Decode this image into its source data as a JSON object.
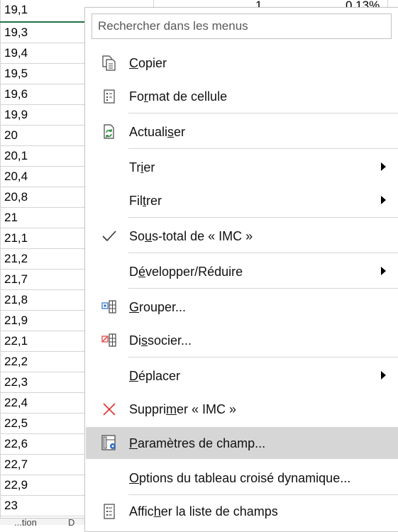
{
  "sheet": {
    "rows": [
      "19,1",
      "19,3",
      "19,4",
      "19,5",
      "19,6",
      "19,9",
      "20",
      "20,1",
      "20,4",
      "20,8",
      "21",
      "21,1",
      "21,2",
      "21,7",
      "21,8",
      "21,9",
      "22,1",
      "22,2",
      "22,3",
      "22,4",
      "22,5",
      "22,6",
      "22,7",
      "22,9",
      "23"
    ],
    "row1_count": "1",
    "row1_percent": "0,13%",
    "tab_fragment_1": "...tion",
    "tab_fragment_2": "D"
  },
  "menu": {
    "search_placeholder": "Rechercher dans les menus",
    "items": [
      {
        "pre": "",
        "u": "C",
        "post": "opier",
        "icon": "copy-icon"
      },
      {
        "pre": "Fo",
        "u": "r",
        "post": "mat de cellule",
        "icon": "format-cells-icon"
      },
      {
        "pre": "Actuali",
        "u": "s",
        "post": "er",
        "icon": "refresh-icon"
      },
      {
        "pre": "Tr",
        "u": "i",
        "post": "er",
        "icon": ""
      },
      {
        "pre": "Fil",
        "u": "t",
        "post": "rer",
        "icon": ""
      },
      {
        "pre": "So",
        "u": "u",
        "post": "s-total de « IMC »",
        "icon": "checkmark-icon"
      },
      {
        "pre": "D",
        "u": "é",
        "post": "velopper/Réduire",
        "icon": ""
      },
      {
        "pre": "",
        "u": "G",
        "post": "rouper...",
        "icon": "group-icon"
      },
      {
        "pre": "Di",
        "u": "s",
        "post": "socier...",
        "icon": "ungroup-icon"
      },
      {
        "pre": "",
        "u": "D",
        "post": "éplacer",
        "icon": ""
      },
      {
        "pre": "Suppri",
        "u": "m",
        "post": "er « IMC »",
        "icon": "delete-x-icon"
      },
      {
        "pre": "",
        "u": "P",
        "post": "aramètres de champ...",
        "icon": "field-settings-icon"
      },
      {
        "pre": "",
        "u": "O",
        "post": "ptions du tableau croisé dynamique...",
        "icon": ""
      },
      {
        "pre": "Affic",
        "u": "h",
        "post": "er la liste de champs",
        "icon": "field-list-icon"
      }
    ]
  },
  "colors": {
    "accent_green": "#217346",
    "hover_gray": "#d6d6d6",
    "refresh_green": "#2e8b3d",
    "danger_red": "#e03a3a",
    "field_settings_blue": "#2b6cc4"
  }
}
